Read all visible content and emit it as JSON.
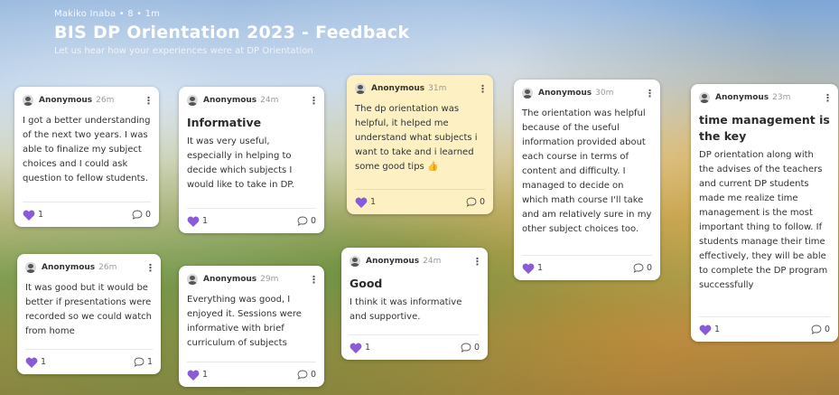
{
  "header": {
    "meta": "Makiko Inaba • 8 • 1m",
    "title": "BIS DP Orientation 2023 - Feedback",
    "subtitle": "Let us hear how your experiences were at DP Orientation"
  },
  "colors": {
    "heart": "#8a5bd6",
    "yellow_card": "#fdf0c2"
  },
  "icons": {
    "like": "heart-icon",
    "comment": "comment-bubble-icon",
    "menu": "kebab-menu-icon"
  },
  "posts": [
    {
      "author": "Anonymous",
      "time": "26m",
      "heading": "",
      "body": "I got a better understanding of the next two years. I was able to finalize my subject choices and I could ask question to fellow students.",
      "likes": "1",
      "comments": "0"
    },
    {
      "author": "Anonymous",
      "time": "24m",
      "heading": "Informative",
      "body": "It was very useful, especially in helping to decide which subjects I would like to take in DP.",
      "likes": "1",
      "comments": "0"
    },
    {
      "author": "Anonymous",
      "time": "31m",
      "heading": "",
      "body": "The dp orientation was helpful, it helped me understand what subjects i want to take and i learned some good tips 👍",
      "likes": "1",
      "comments": "0"
    },
    {
      "author": "Anonymous",
      "time": "30m",
      "heading": "",
      "body": "The orientation was helpful because of the useful information provided about each course in terms of content and difficulty. I managed to decide on which math course I'll take and am relatively sure in my other subject choices too.",
      "likes": "1",
      "comments": "0"
    },
    {
      "author": "Anonymous",
      "time": "23m",
      "heading": "time management is the key",
      "body": "DP orientation along with the advises of the teachers and current DP students made me realize time management is the most important thing to follow. If students manage their time effectively, they will be able to complete the DP program successfully",
      "likes": "1",
      "comments": "0"
    },
    {
      "author": "Anonymous",
      "time": "26m",
      "heading": "",
      "body": "It was good but it would be better if presentations were recorded so we could watch from home",
      "likes": "1",
      "comments": "1"
    },
    {
      "author": "Anonymous",
      "time": "29m",
      "heading": "",
      "body": "Everything was good, I enjoyed it. Sessions were informative with brief curriculum of subjects",
      "likes": "1",
      "comments": "0"
    },
    {
      "author": "Anonymous",
      "time": "24m",
      "heading": "Good",
      "body": "I think it was informative and supportive.",
      "likes": "1",
      "comments": "0"
    }
  ]
}
